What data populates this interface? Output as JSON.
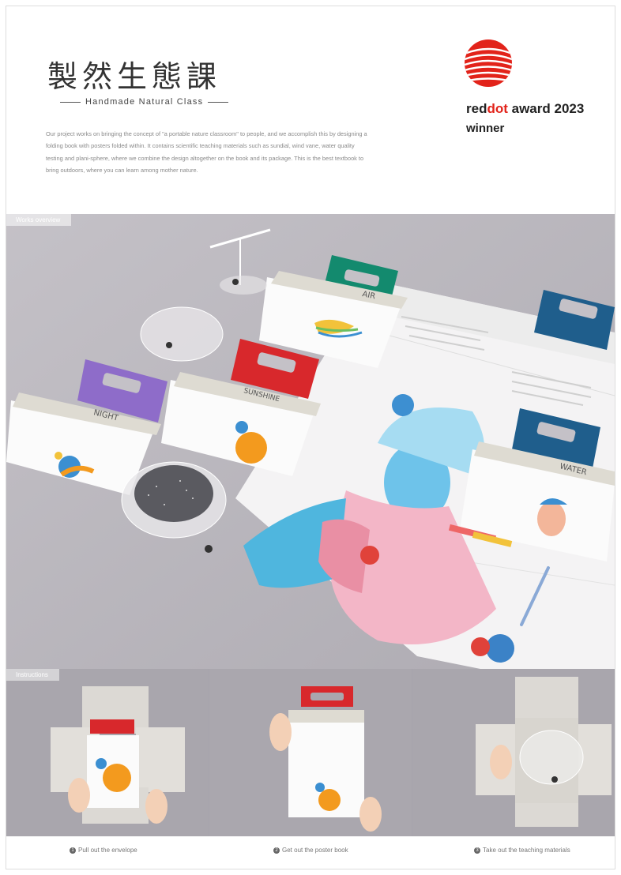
{
  "header": {
    "title_cn": "製然生態課",
    "title_en": "Handmade  Natural  Class",
    "intro": "Our project works on bringing the concept of  \"a portable nature classroom\"  to people, and we accomplish this by designing a folding book with posters folded within. It contains scientific teaching materials such as sundial, wind vane, water quality testing and plani-sphere, where we combine the design altogether on the book and its package. This is the best textbook to bring outdoors, where you can learn among mother nature."
  },
  "award": {
    "brand_prefix": "red",
    "brand_highlight": "dot",
    "rest": " award 2023",
    "winner": "winner",
    "logo_icon": "reddot-logo-icon",
    "brand_color": "#e2231a"
  },
  "overview": {
    "label": "Works overview",
    "books": [
      {
        "name": "NIGHT",
        "tab_color": "#8e6cc9"
      },
      {
        "name": "SUNSHINE",
        "tab_color": "#d8282c"
      },
      {
        "name": "AIR",
        "tab_color": "#138a6e"
      },
      {
        "name": "WATER",
        "tab_color": "#1f5e8c"
      }
    ]
  },
  "instructions": {
    "label": "Instructions",
    "steps": [
      {
        "num": "1",
        "text": "Pull out the envelope"
      },
      {
        "num": "2",
        "text": "Get out the poster book"
      },
      {
        "num": "3",
        "text": "Take out the teaching materials"
      }
    ]
  }
}
